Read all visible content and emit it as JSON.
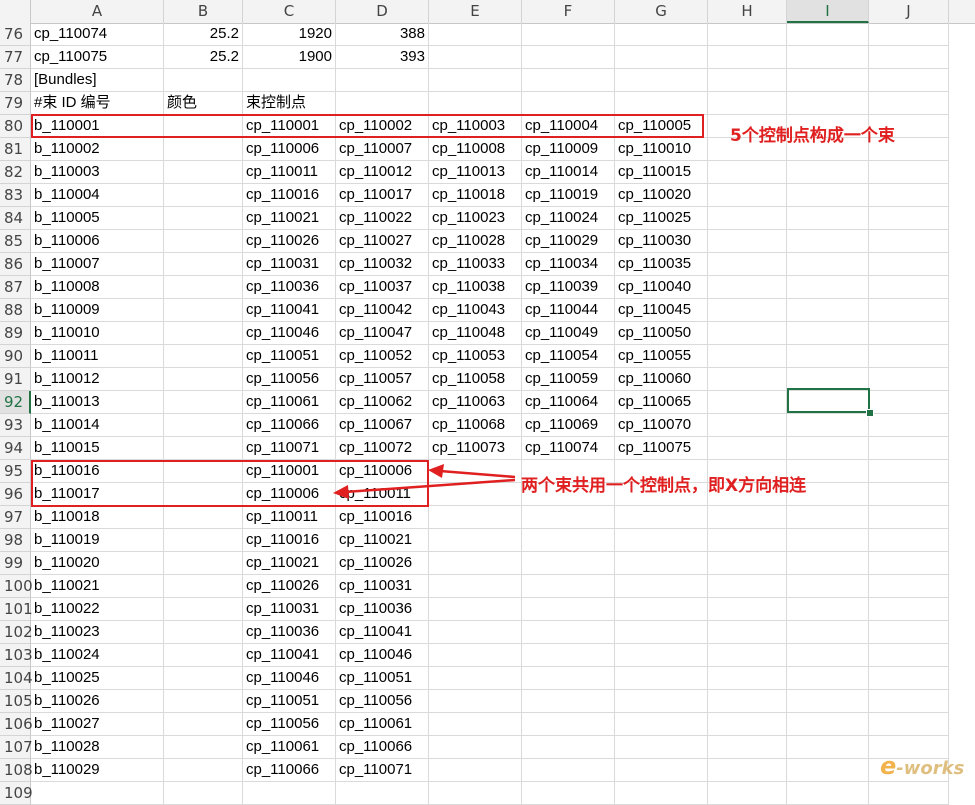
{
  "columns": [
    "A",
    "B",
    "C",
    "D",
    "E",
    "F",
    "G",
    "H",
    "I",
    "J"
  ],
  "selected_column": "I",
  "selected_row": "92",
  "rows": [
    {
      "num": "76",
      "cells": [
        "cp_110074",
        "25.2",
        "1920",
        "388",
        "",
        "",
        ""
      ]
    },
    {
      "num": "77",
      "cells": [
        "cp_110075",
        "25.2",
        "1900",
        "393",
        "",
        "",
        ""
      ]
    },
    {
      "num": "78",
      "cells": [
        "[Bundles]",
        "",
        "",
        "",
        "",
        "",
        ""
      ]
    },
    {
      "num": "79",
      "cells": [
        "#束 ID 编号",
        "颜色",
        "束控制点",
        "",
        "",
        "",
        ""
      ]
    },
    {
      "num": "80",
      "cells": [
        "b_110001",
        "",
        "cp_110001",
        "cp_110002",
        "cp_110003",
        "cp_110004",
        "cp_110005"
      ]
    },
    {
      "num": "81",
      "cells": [
        "b_110002",
        "",
        "cp_110006",
        "cp_110007",
        "cp_110008",
        "cp_110009",
        "cp_110010"
      ]
    },
    {
      "num": "82",
      "cells": [
        "b_110003",
        "",
        "cp_110011",
        "cp_110012",
        "cp_110013",
        "cp_110014",
        "cp_110015"
      ]
    },
    {
      "num": "83",
      "cells": [
        "b_110004",
        "",
        "cp_110016",
        "cp_110017",
        "cp_110018",
        "cp_110019",
        "cp_110020"
      ]
    },
    {
      "num": "84",
      "cells": [
        "b_110005",
        "",
        "cp_110021",
        "cp_110022",
        "cp_110023",
        "cp_110024",
        "cp_110025"
      ]
    },
    {
      "num": "85",
      "cells": [
        "b_110006",
        "",
        "cp_110026",
        "cp_110027",
        "cp_110028",
        "cp_110029",
        "cp_110030"
      ]
    },
    {
      "num": "86",
      "cells": [
        "b_110007",
        "",
        "cp_110031",
        "cp_110032",
        "cp_110033",
        "cp_110034",
        "cp_110035"
      ]
    },
    {
      "num": "87",
      "cells": [
        "b_110008",
        "",
        "cp_110036",
        "cp_110037",
        "cp_110038",
        "cp_110039",
        "cp_110040"
      ]
    },
    {
      "num": "88",
      "cells": [
        "b_110009",
        "",
        "cp_110041",
        "cp_110042",
        "cp_110043",
        "cp_110044",
        "cp_110045"
      ]
    },
    {
      "num": "89",
      "cells": [
        "b_110010",
        "",
        "cp_110046",
        "cp_110047",
        "cp_110048",
        "cp_110049",
        "cp_110050"
      ]
    },
    {
      "num": "90",
      "cells": [
        "b_110011",
        "",
        "cp_110051",
        "cp_110052",
        "cp_110053",
        "cp_110054",
        "cp_110055"
      ]
    },
    {
      "num": "91",
      "cells": [
        "b_110012",
        "",
        "cp_110056",
        "cp_110057",
        "cp_110058",
        "cp_110059",
        "cp_110060"
      ]
    },
    {
      "num": "92",
      "cells": [
        "b_110013",
        "",
        "cp_110061",
        "cp_110062",
        "cp_110063",
        "cp_110064",
        "cp_110065"
      ]
    },
    {
      "num": "93",
      "cells": [
        "b_110014",
        "",
        "cp_110066",
        "cp_110067",
        "cp_110068",
        "cp_110069",
        "cp_110070"
      ]
    },
    {
      "num": "94",
      "cells": [
        "b_110015",
        "",
        "cp_110071",
        "cp_110072",
        "cp_110073",
        "cp_110074",
        "cp_110075"
      ]
    },
    {
      "num": "95",
      "cells": [
        "b_110016",
        "",
        "cp_110001",
        "cp_110006",
        "",
        "",
        ""
      ]
    },
    {
      "num": "96",
      "cells": [
        "b_110017",
        "",
        "cp_110006",
        "cp_110011",
        "",
        "",
        ""
      ]
    },
    {
      "num": "97",
      "cells": [
        "b_110018",
        "",
        "cp_110011",
        "cp_110016",
        "",
        "",
        ""
      ]
    },
    {
      "num": "98",
      "cells": [
        "b_110019",
        "",
        "cp_110016",
        "cp_110021",
        "",
        "",
        ""
      ]
    },
    {
      "num": "99",
      "cells": [
        "b_110020",
        "",
        "cp_110021",
        "cp_110026",
        "",
        "",
        ""
      ]
    },
    {
      "num": "100",
      "cells": [
        "b_110021",
        "",
        "cp_110026",
        "cp_110031",
        "",
        "",
        ""
      ]
    },
    {
      "num": "101",
      "cells": [
        "b_110022",
        "",
        "cp_110031",
        "cp_110036",
        "",
        "",
        ""
      ]
    },
    {
      "num": "102",
      "cells": [
        "b_110023",
        "",
        "cp_110036",
        "cp_110041",
        "",
        "",
        ""
      ]
    },
    {
      "num": "103",
      "cells": [
        "b_110024",
        "",
        "cp_110041",
        "cp_110046",
        "",
        "",
        ""
      ]
    },
    {
      "num": "104",
      "cells": [
        "b_110025",
        "",
        "cp_110046",
        "cp_110051",
        "",
        "",
        ""
      ]
    },
    {
      "num": "105",
      "cells": [
        "b_110026",
        "",
        "cp_110051",
        "cp_110056",
        "",
        "",
        ""
      ]
    },
    {
      "num": "106",
      "cells": [
        "b_110027",
        "",
        "cp_110056",
        "cp_110061",
        "",
        "",
        ""
      ]
    },
    {
      "num": "107",
      "cells": [
        "b_110028",
        "",
        "cp_110061",
        "cp_110066",
        "",
        "",
        ""
      ]
    },
    {
      "num": "108",
      "cells": [
        "b_110029",
        "",
        "cp_110066",
        "cp_110071",
        "",
        "",
        ""
      ]
    },
    {
      "num": "109",
      "cells": [
        "",
        "",
        "",
        "",
        "",
        "",
        ""
      ]
    }
  ],
  "annotations": {
    "bundle_note": "5个控制点构成一个束",
    "shared_note": "两个束共用一个控制点，即X方向相连"
  },
  "watermark": {
    "e": "e",
    "rest": "-works"
  },
  "colors": {
    "annotation": "#e02020",
    "selection": "#217346"
  }
}
